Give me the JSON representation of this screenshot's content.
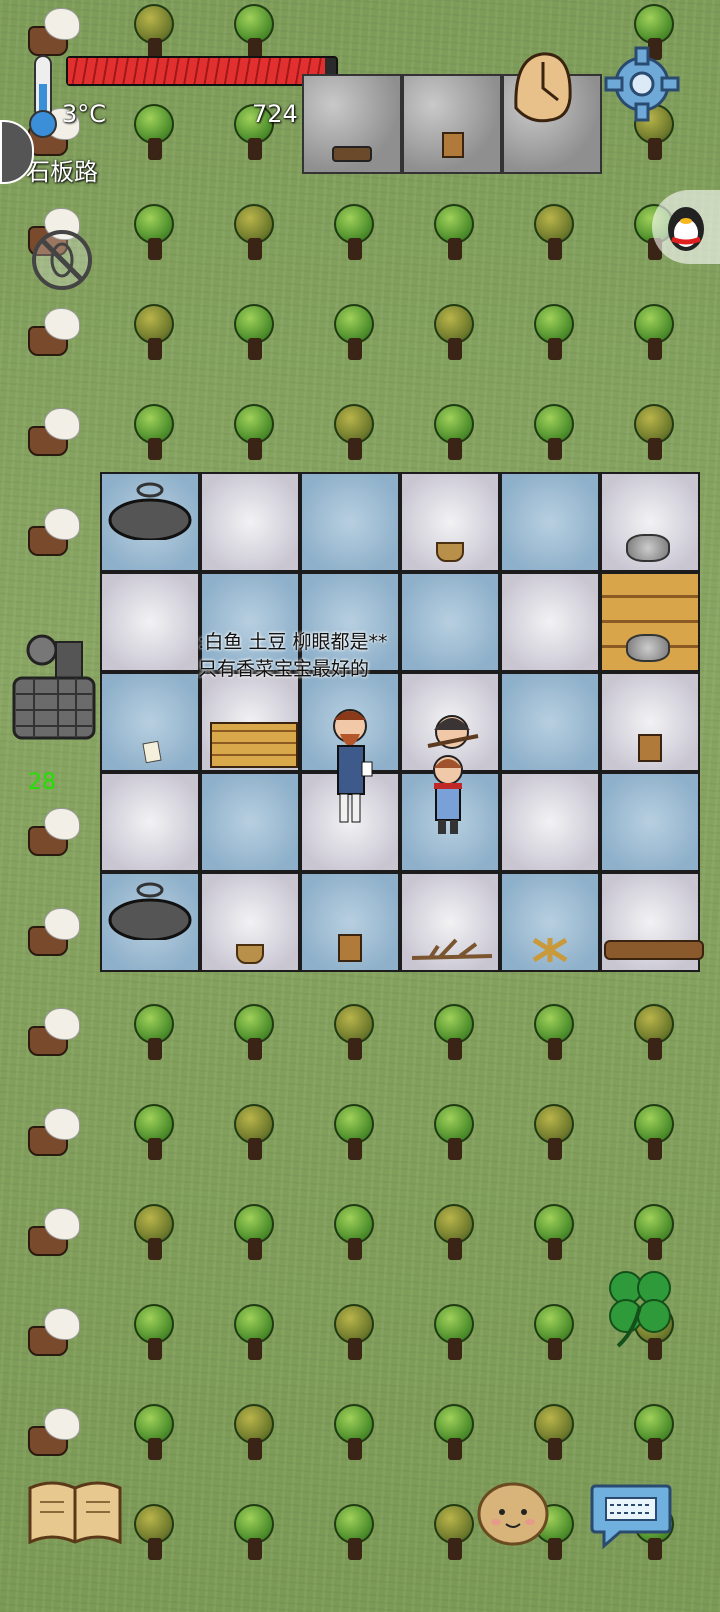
{
  "hud": {
    "temperature": "3°C",
    "location": "石板路",
    "counter": "724",
    "health_fill": 0.96,
    "side_number": "28"
  },
  "speech": {
    "line1": ":白鱼 土豆 柳眼都是**",
    "line2": "只有香菜宝宝最好的"
  },
  "icons": {
    "thermometer": "thermometer-icon",
    "settings": "gear-icon",
    "clock": "melted-clock-icon",
    "no_bug": "no-bug-icon",
    "clover": "four-leaf-clover-icon",
    "book": "book-icon",
    "potato": "potato-face-icon",
    "keyboard": "keyboard-icon",
    "chat_head": "chat-head-icon",
    "qq": "qq-penguin-icon"
  },
  "colors": {
    "grass": "#7d9c58",
    "health_red": "#d8262a",
    "side_number": "#22e000",
    "blue_tile": "#9bbbd3",
    "white_tile": "#e6e4ec"
  }
}
